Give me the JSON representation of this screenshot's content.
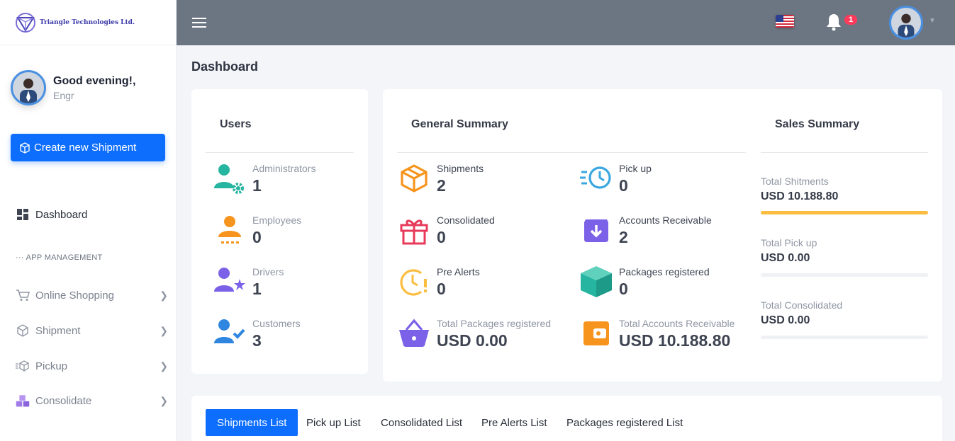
{
  "brand": {
    "name": "Triangle Technologies Ltd."
  },
  "profile": {
    "greeting": "Good evening!,",
    "role": "Engr"
  },
  "sidebar": {
    "create_button": "Create new Shipment",
    "dashboard": "Dashboard",
    "section": "APP MANAGEMENT",
    "items": [
      {
        "label": "Online Shopping",
        "icon": "cart-icon"
      },
      {
        "label": "Shipment",
        "icon": "box-icon"
      },
      {
        "label": "Pickup",
        "icon": "fast-box-icon"
      },
      {
        "label": "Consolidate",
        "icon": "stacked-boxes-icon"
      }
    ]
  },
  "topbar": {
    "notifications": "1"
  },
  "page": {
    "title": "Dashboard"
  },
  "users": {
    "title": "Users",
    "items": [
      {
        "label": "Administrators",
        "value": "1"
      },
      {
        "label": "Employees",
        "value": "0"
      },
      {
        "label": "Drivers",
        "value": "1"
      },
      {
        "label": "Customers",
        "value": "3"
      }
    ]
  },
  "general": {
    "title": "General Summary",
    "items": [
      {
        "label": "Shipments",
        "value": "2"
      },
      {
        "label": "Pick up",
        "value": "0"
      },
      {
        "label": "Consolidated",
        "value": "0"
      },
      {
        "label": "Accounts Receivable",
        "value": "2"
      },
      {
        "label": "Pre Alerts",
        "value": "0"
      },
      {
        "label": "Packages registered",
        "value": "0"
      },
      {
        "label": "Total Packages registered",
        "value": "USD 0.00"
      },
      {
        "label": "Total Accounts Receivable",
        "value": "USD 10.188.80"
      }
    ]
  },
  "sales": {
    "title": "Sales Summary",
    "items": [
      {
        "label": "Total Shitments",
        "value": "USD 10.188.80",
        "progress": 1.0
      },
      {
        "label": "Total Pick up",
        "value": "USD 0.00",
        "progress": 0
      },
      {
        "label": "Total Consolidated",
        "value": "USD 0.00",
        "progress": 0
      }
    ]
  },
  "tabs": [
    "Shipments List",
    "Pick up List",
    "Consolidated List",
    "Pre Alerts List",
    "Packages registered List"
  ],
  "colors": {
    "primary": "#0d6efd",
    "teal": "#26b5a0",
    "orange": "#f7941d",
    "purple": "#7b61e8",
    "blue": "#2f86e0",
    "red": "#e83a5a",
    "yellow": "#fbbd40",
    "topbar": "#6c7582"
  }
}
